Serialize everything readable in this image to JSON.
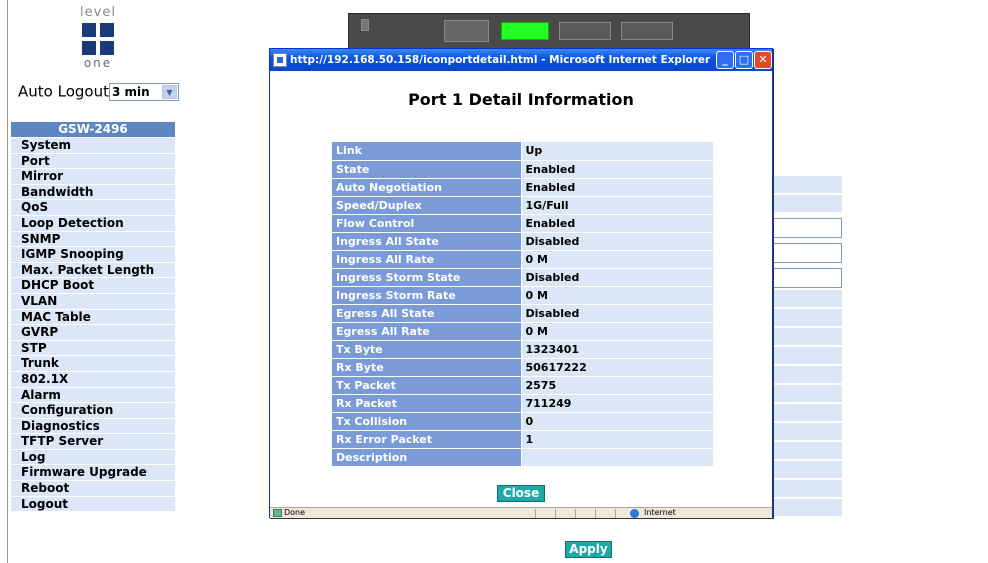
{
  "logo": {
    "top_text": "level",
    "bottom_text": "one"
  },
  "auto_logout": {
    "label": "Auto Logout",
    "selected": "3 min"
  },
  "menu": {
    "header": "GSW-2496",
    "items": [
      "System",
      "Port",
      "Mirror",
      "Bandwidth",
      "QoS",
      "Loop Detection",
      "SNMP",
      "IGMP Snooping",
      "Max. Packet Length",
      "DHCP Boot",
      "VLAN",
      "MAC Table",
      "GVRP",
      "STP",
      "Trunk",
      "802.1X",
      "Alarm",
      "Configuration",
      "Diagnostics",
      "TFTP Server",
      "Log",
      "Firmware Upgrade",
      "Reboot",
      "Logout"
    ]
  },
  "apply_label": "Apply",
  "popup": {
    "window_title": "http://192.168.50.158/iconportdetail.html - Microsoft Internet Explorer",
    "heading": "Port 1 Detail Information",
    "rows": [
      {
        "key": "Link",
        "value": "Up"
      },
      {
        "key": "State",
        "value": "Enabled"
      },
      {
        "key": "Auto Negotiation",
        "value": "Enabled"
      },
      {
        "key": "Speed/Duplex",
        "value": "1G/Full"
      },
      {
        "key": "Flow Control",
        "value": "Enabled"
      },
      {
        "key": "Ingress All State",
        "value": "Disabled"
      },
      {
        "key": "Ingress All Rate",
        "value": "0 M"
      },
      {
        "key": "Ingress Storm State",
        "value": "Disabled"
      },
      {
        "key": "Ingress Storm Rate",
        "value": "0 M"
      },
      {
        "key": "Egress All State",
        "value": "Disabled"
      },
      {
        "key": "Egress All Rate",
        "value": "0 M"
      },
      {
        "key": "Tx Byte",
        "value": "1323401"
      },
      {
        "key": "Rx Byte",
        "value": "50617222"
      },
      {
        "key": "Tx Packet",
        "value": "2575"
      },
      {
        "key": "Rx Packet",
        "value": "711249"
      },
      {
        "key": "Tx Collision",
        "value": "0"
      },
      {
        "key": "Rx Error Packet",
        "value": "1"
      },
      {
        "key": "Description",
        "value": ""
      }
    ],
    "close_label": "Close",
    "status_left": "Done",
    "status_zone": "Internet"
  },
  "colors": {
    "menu_header": "#5e87c2",
    "menu_item_bg": "#dbe7f7",
    "key_cell_bg": "#7a9ad8",
    "button_bg": "#1ea8a8",
    "titlebar": "#0a55e0"
  }
}
